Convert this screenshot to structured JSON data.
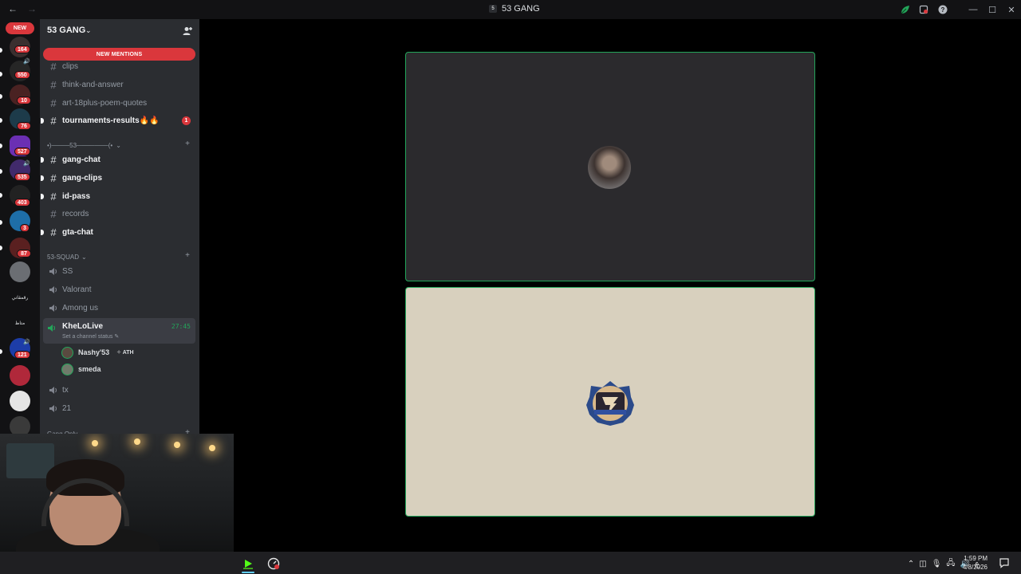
{
  "window": {
    "title": "53 GANG",
    "back_glyph": "←",
    "forward_glyph": "→",
    "minimize_glyph": "—",
    "maximize_glyph": "☐",
    "close_glyph": "✕"
  },
  "rail": {
    "new_label": "NEW",
    "servers": [
      {
        "badge": "164",
        "color": "#3a2f2f"
      },
      {
        "badge": "550",
        "color": "#262626"
      },
      {
        "badge": "10",
        "color": "#4a2222"
      },
      {
        "badge": "76",
        "color": "#1d3b4a"
      },
      {
        "badge": "527",
        "color": "#6b2fb3"
      },
      {
        "badge": "535",
        "color": "#412a6b"
      },
      {
        "badge": "403",
        "color": "#222222"
      },
      {
        "badge": "3",
        "color": "#1e6ea8"
      },
      {
        "badge": "87",
        "color": "#5a2020"
      },
      {
        "badge": "",
        "color": "#6b6e73"
      },
      {
        "badge": "",
        "color": "#121214",
        "text": "رقمقاني"
      },
      {
        "badge": "",
        "color": "#121214",
        "text": "متاظ"
      },
      {
        "badge": "121",
        "color": "#1d3da8"
      },
      {
        "badge": "",
        "color": "#b0283a"
      },
      {
        "badge": "",
        "color": "#e5e5e5"
      },
      {
        "badge": "",
        "color": "#3a3a3a"
      }
    ]
  },
  "sidebar": {
    "server_name": "53 GANG",
    "mentions_label": "NEW MENTIONS",
    "channels_top": [
      {
        "label": "clips",
        "unread": false,
        "badge": ""
      },
      {
        "label": "think-and-answer",
        "unread": false,
        "badge": ""
      },
      {
        "label": "art-18plus-poem-quotes",
        "unread": false,
        "badge": ""
      },
      {
        "label": "tournaments-results🔥🔥",
        "unread": true,
        "badge": "1"
      }
    ],
    "category1": "•)────53───────(•",
    "channels_mid": [
      {
        "label": "gang-chat",
        "unread": true
      },
      {
        "label": "gang-clips",
        "unread": true
      },
      {
        "label": "id-pass",
        "unread": true
      },
      {
        "label": "records",
        "unread": false
      },
      {
        "label": "gta-chat",
        "unread": true
      }
    ],
    "category2": "53-SQUAD",
    "voice_channels": [
      {
        "label": "SS"
      },
      {
        "label": "Valorant"
      },
      {
        "label": "Among us"
      }
    ],
    "active_voice": {
      "label": "KheLoLive",
      "timer": "27:45",
      "status": "Set a channel status"
    },
    "voice_users": [
      {
        "name": "Nashy'53",
        "tag": "ATH"
      },
      {
        "name": "smeda",
        "tag": ""
      }
    ],
    "voice_channels_after": [
      {
        "label": "tx"
      },
      {
        "label": "21"
      }
    ],
    "category3": "Gang Only"
  },
  "taskbar": {
    "time": "1:59 PM",
    "date": "4/8/2026",
    "lang": "ع"
  },
  "colors": {
    "accent_green": "#23a55a",
    "mention_red": "#da373c"
  }
}
